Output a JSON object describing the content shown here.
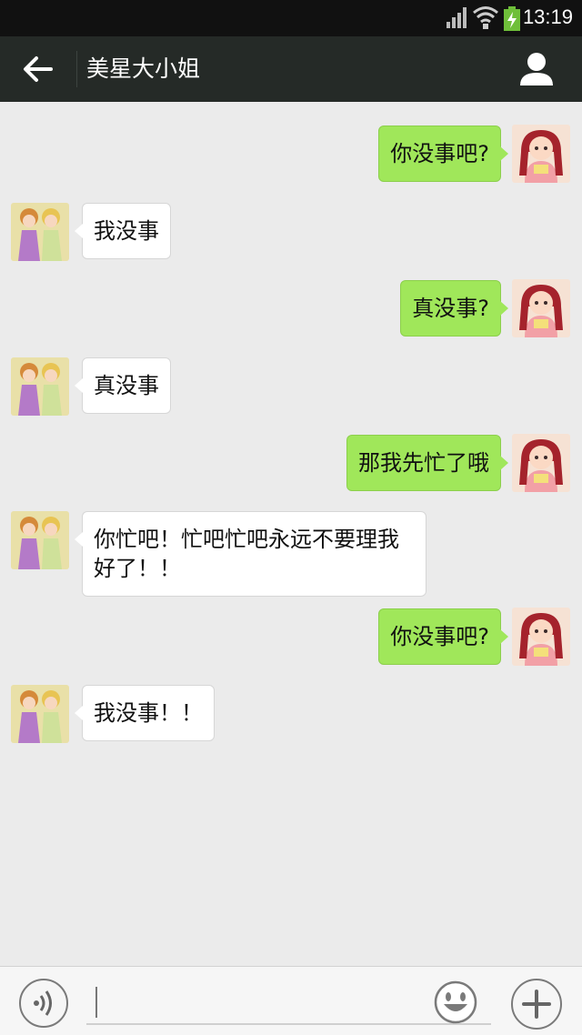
{
  "status_bar": {
    "time": "13:19"
  },
  "header": {
    "title": "美星大小姐"
  },
  "messages": [
    {
      "side": "out",
      "text": "你没事吧?"
    },
    {
      "side": "in",
      "text": "我没事"
    },
    {
      "side": "out",
      "text": "真没事?"
    },
    {
      "side": "in",
      "text": "真没事"
    },
    {
      "side": "out",
      "text": "那我先忙了哦"
    },
    {
      "side": "in",
      "line1": "你忙吧！忙吧忙吧永远不要理我",
      "line2": "好了！！"
    },
    {
      "side": "out",
      "text": "你没事吧?"
    },
    {
      "side": "in",
      "text": "我没事！！"
    }
  ],
  "colors": {
    "outgoing_bubble": "#a0e75a",
    "incoming_bubble": "#ffffff",
    "title_bar": "#252a27",
    "background": "#ebebeb"
  },
  "icons": [
    "back-arrow-icon",
    "profile-icon",
    "voice-icon",
    "emoji-icon",
    "plus-icon",
    "signal-icon",
    "wifi-icon",
    "battery-icon"
  ]
}
